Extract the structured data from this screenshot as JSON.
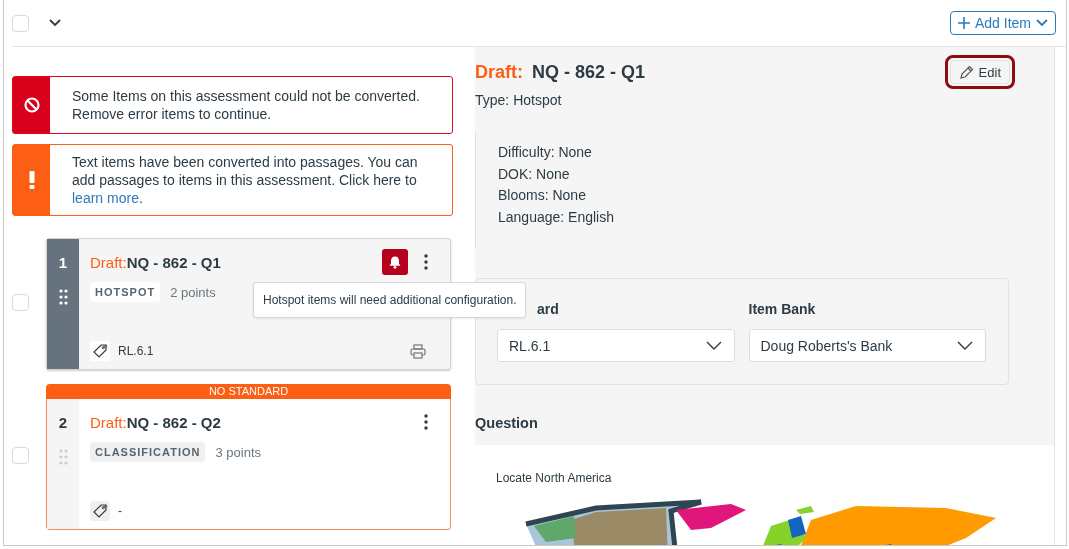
{
  "header": {
    "select_all": {
      "checked": false
    },
    "add_item_button": "Add Item"
  },
  "alerts": [
    {
      "kind": "error",
      "text": "Some Items on this assessment could not be converted. Remove error items to continue."
    },
    {
      "kind": "warning",
      "text": "Text items have been converted into passages. You can add passages to items in this assessment. Click here to",
      "link": "learn more",
      "text_after": "."
    }
  ],
  "items": [
    {
      "number": "1",
      "draft_label": "Draft:",
      "title": "NQ - 862 - Q1",
      "type": "HOTSPOT",
      "points": "2 points",
      "standard": "RL.6.1",
      "selected": true,
      "checked": false,
      "alert": true,
      "tooltip": "Hotspot items will need additional configuration."
    },
    {
      "number": "2",
      "banner": "NO STANDARD",
      "draft_label": "Draft:",
      "title": "NQ - 862 - Q2",
      "type": "CLASSIFICATION",
      "points": "3 points",
      "standard": "-",
      "selected": false,
      "checked": false,
      "alert": false
    }
  ],
  "detail": {
    "draft_label": "Draft:",
    "title": "NQ - 862 - Q1",
    "edit_button": "Edit",
    "type": "Type: Hotspot",
    "metadata": [
      "Difficulty: None",
      "DOK: None",
      "Blooms: None",
      "Language: English"
    ],
    "standard": {
      "label": "ard",
      "value": "RL.6.1"
    },
    "item_bank": {
      "label": "Item Bank",
      "value": "Doug Roberts's Bank"
    },
    "question_heading": "Question",
    "question_text": "Locate North America"
  }
}
